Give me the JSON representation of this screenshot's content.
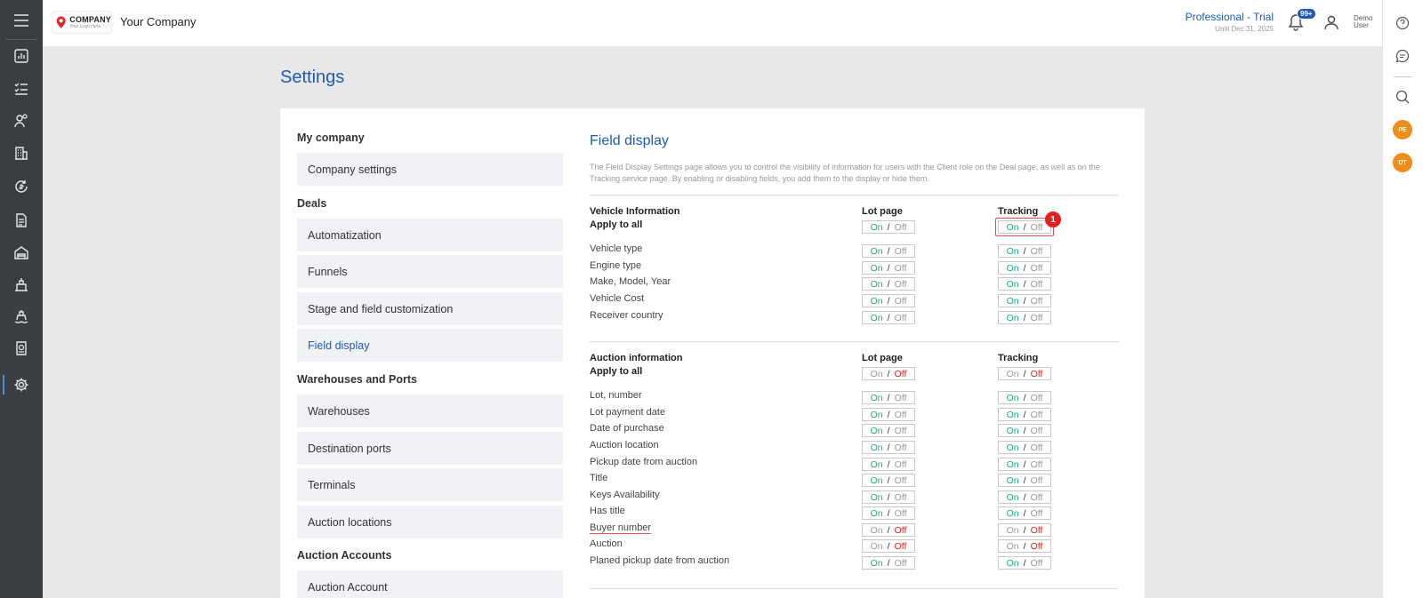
{
  "header": {
    "logo_big": "COMPANY",
    "logo_small": "Your Logo Here",
    "company_name": "Your Company",
    "plan_title": "Professional - Trial",
    "plan_until": "Until Dec 31, 2025",
    "notification_badge": "99+",
    "user_first": "Demo",
    "user_last": "User"
  },
  "sidebar_icons": [
    "menu-icon",
    "dashboard-icon",
    "tasks-icon",
    "contacts-icon",
    "companies-icon",
    "finance-icon",
    "documents-icon",
    "warehouse-icon",
    "shipping-icon",
    "port-icon",
    "reports-icon",
    "settings-icon"
  ],
  "rightbar": {
    "avatar1": "PE",
    "avatar2": "DT"
  },
  "page": {
    "title": "Settings"
  },
  "side_nav": {
    "group_my_company": "My company",
    "company_settings": "Company settings",
    "group_deals": "Deals",
    "automatization": "Automatization",
    "funnels": "Funnels",
    "stage_customization": "Stage and field customization",
    "field_display": "Field display",
    "group_warehouses": "Warehouses and Ports",
    "warehouses": "Warehouses",
    "destination_ports": "Destination ports",
    "terminals": "Terminals",
    "auction_locations": "Auction locations",
    "group_auction_accounts": "Auction Accounts",
    "auction_account": "Auction Account"
  },
  "field_display": {
    "title": "Field display",
    "description": "The Field Display Settings page allows you to control the visibility of information for users with the Client role on the Deal page, as well as on the Tracking service page. By enabling or disabling fields, you add them to the display or hide them.",
    "toggle_on": "On",
    "toggle_off": "Off",
    "toggle_slash": "/",
    "marker": "1",
    "col_lot": "Lot page",
    "col_tracking": "Tracking",
    "vehicle": {
      "heading": "Vehicle Information",
      "rows": [
        {
          "label": "Apply to all",
          "lot": "on",
          "tracking": "on"
        },
        {
          "label": "Vehicle type",
          "lot": "on",
          "tracking": "on"
        },
        {
          "label": "Engine type",
          "lot": "on",
          "tracking": "on"
        },
        {
          "label": "Make, Model, Year",
          "lot": "on",
          "tracking": "on"
        },
        {
          "label": "Vehicle Cost",
          "lot": "on",
          "tracking": "on"
        },
        {
          "label": "Receiver country",
          "lot": "on",
          "tracking": "on"
        }
      ]
    },
    "auction": {
      "heading": "Auction information",
      "rows": [
        {
          "label": "Apply to all",
          "lot": "off",
          "tracking": "off"
        },
        {
          "label": "Lot, number",
          "lot": "on",
          "tracking": "on"
        },
        {
          "label": "Lot payment date",
          "lot": "on",
          "tracking": "on"
        },
        {
          "label": "Date of purchase",
          "lot": "on",
          "tracking": "on"
        },
        {
          "label": "Auction location",
          "lot": "on",
          "tracking": "on"
        },
        {
          "label": "Pickup date from auction",
          "lot": "on",
          "tracking": "on"
        },
        {
          "label": "Title",
          "lot": "on",
          "tracking": "on"
        },
        {
          "label": "Keys Availability",
          "lot": "on",
          "tracking": "on"
        },
        {
          "label": "Has title",
          "lot": "on",
          "tracking": "on"
        },
        {
          "label": "Buyer number",
          "lot": "off",
          "tracking": "off"
        },
        {
          "label": "Auction",
          "lot": "off",
          "tracking": "off"
        },
        {
          "label": "Planed pickup date from auction",
          "lot": "on",
          "tracking": "on"
        }
      ]
    }
  }
}
